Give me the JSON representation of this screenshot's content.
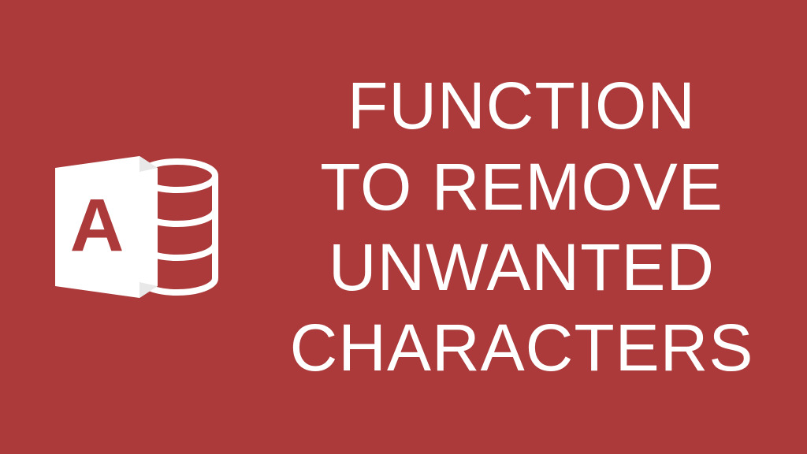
{
  "colors": {
    "background": "#ac3a3a",
    "text": "#ffffff",
    "icon": "#ffffff"
  },
  "heading": {
    "line1": "FUNCTION",
    "line2": "TO REMOVE",
    "line3": "UNWANTED",
    "line4": "CHARACTERS"
  },
  "icon": {
    "name": "microsoft-access-icon",
    "letter": "A"
  }
}
